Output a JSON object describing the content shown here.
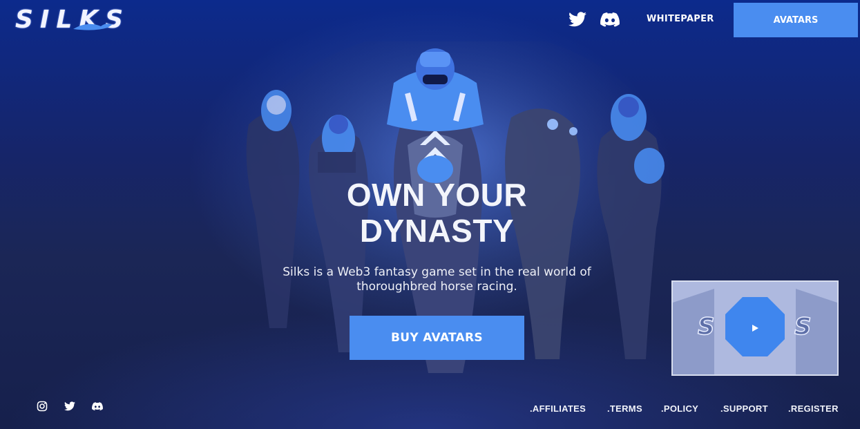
{
  "brand": {
    "logo_text": "SILKS"
  },
  "nav": {
    "icons": [
      "twitter-icon",
      "discord-icon"
    ],
    "whitepaper_label": "WHITEPAPER",
    "avatars_label": "AVATARS"
  },
  "hero": {
    "headline_line1": "OWN YOUR",
    "headline_line2": "DYNASTY",
    "subtitle_line1": "Silks is a Web3 fantasy game set in the real world of",
    "subtitle_line2": "thoroughbred horse racing.",
    "cta_label": "BUY AVATARS"
  },
  "video": {
    "icon": "play-icon"
  },
  "footer": {
    "social_icons": [
      "instagram-icon",
      "twitter-icon",
      "discord-icon"
    ],
    "links": [
      ".AFFILIATES",
      ".TERMS",
      ".POLICY",
      ".SUPPORT",
      ".REGISTER"
    ]
  },
  "colors": {
    "accent": "#4a8df0",
    "background": "#16204c"
  }
}
